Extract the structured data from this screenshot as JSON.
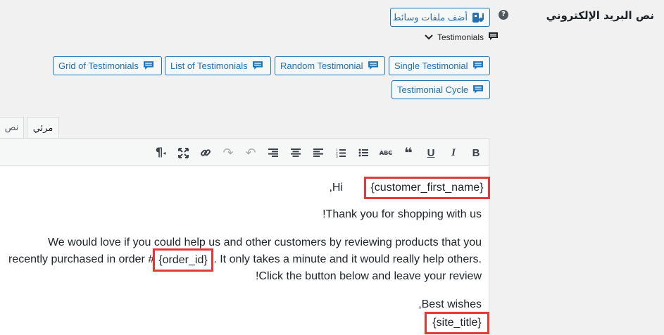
{
  "field": {
    "label": "نص البريد الإلكتروني",
    "help_glyph": "?"
  },
  "media_button": {
    "label": "أضف ملفات وسائط"
  },
  "testimonials_dropdown": {
    "label": "Testimonials"
  },
  "shortcode_buttons": [
    {
      "label": "Grid of Testimonials"
    },
    {
      "label": "List of Testimonials"
    },
    {
      "label": "Random Testimonial"
    },
    {
      "label": "Single Testimonial"
    },
    {
      "label": "Testimonial Cycle"
    }
  ],
  "tabs": {
    "visual": "مرئي",
    "text": "نص"
  },
  "toolbar": [
    {
      "name": "bold",
      "glyph": "B"
    },
    {
      "name": "italic",
      "glyph": "I"
    },
    {
      "name": "underline",
      "glyph": "U"
    },
    {
      "name": "blockquote",
      "glyph": "❝"
    },
    {
      "name": "strikethrough",
      "glyph": "ABC"
    },
    {
      "name": "bullet-list",
      "glyph": "•≡"
    },
    {
      "name": "numbered-list",
      "glyph": "1≡"
    },
    {
      "name": "align-left",
      "glyph": "≡"
    },
    {
      "name": "align-center",
      "glyph": "≡"
    },
    {
      "name": "align-right",
      "glyph": "≡"
    },
    {
      "name": "undo",
      "glyph": "↶"
    },
    {
      "name": "redo",
      "glyph": "↷"
    },
    {
      "name": "link",
      "glyph": "🔗"
    },
    {
      "name": "fullscreen",
      "glyph": "⤧"
    },
    {
      "name": "paragraph-rtl",
      "glyph": "¶"
    }
  ],
  "content": {
    "greeting_suffix": ",Hi",
    "customer_tag": "{customer_first_name}",
    "thanks": "!Thank you for shopping with us",
    "para1_line1": "We would love if you could help us and other customers by reviewing products that you",
    "para1_line2_prefix": "recently purchased in order #",
    "order_tag": "{order_id}",
    "para1_line2_suffix": ". It only takes a minute and it would really help others.",
    "para1_line3": "!Click the button below and leave your review",
    "best_wishes": ",Best wishes",
    "site_tag": "{site_title}"
  },
  "colors": {
    "accent": "#2271b1",
    "highlight": "#e53935"
  }
}
